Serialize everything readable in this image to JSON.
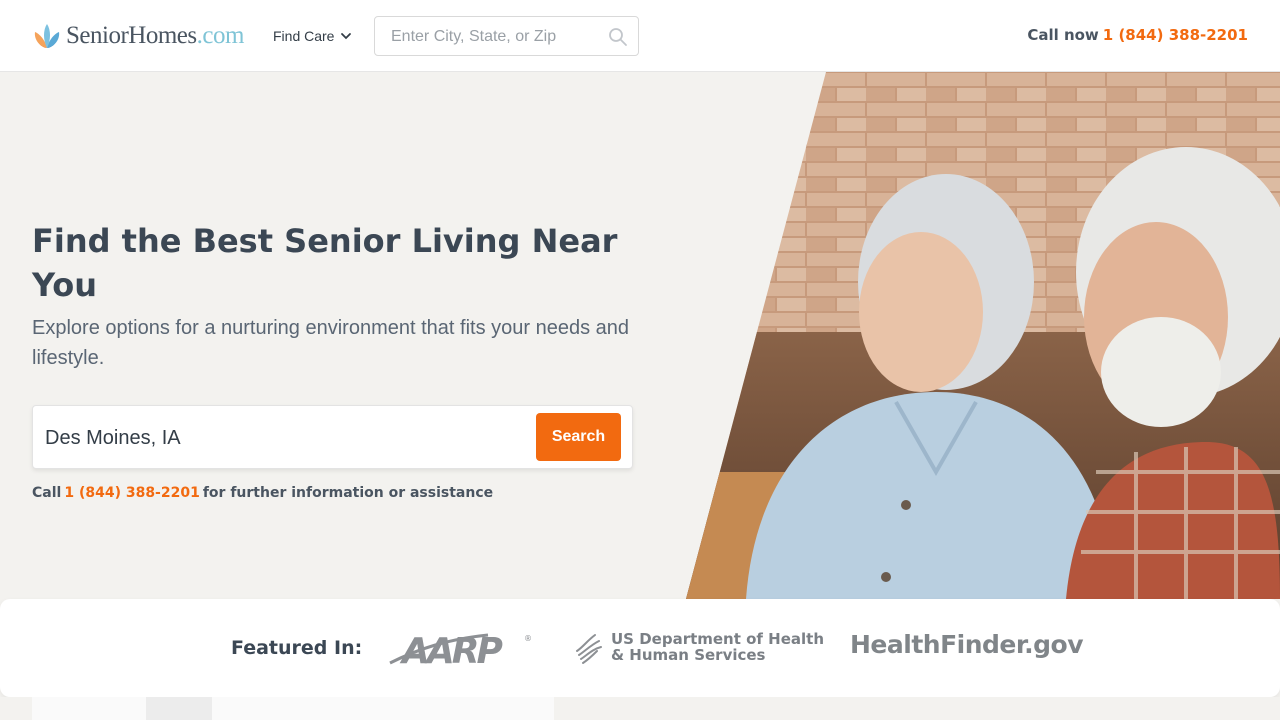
{
  "header": {
    "logo_text": "SeniorHomes",
    "logo_suffix": ".com",
    "find_care_label": "Find Care",
    "search_placeholder": "Enter City, State, or Zip",
    "call_label": "Call now",
    "phone": "1 (844) 388-2201"
  },
  "hero": {
    "title": "Find the Best Senior Living Near You",
    "subtitle": "Explore options for a nurturing environment that fits your needs and lifestyle.",
    "search_value": "Des Moines, IA",
    "search_button": "Search",
    "call_prefix": "Call",
    "call_phone": "1 (844) 388-2201",
    "call_suffix": "for further information or assistance"
  },
  "featured": {
    "label": "Featured In:",
    "logos": [
      "AARP",
      "US Department of Health & Human Services",
      "HealthFinder.gov"
    ],
    "hhs_line1": "US Department of Health",
    "hhs_line2": "& Human Services",
    "healthfinder": "HealthFinder.gov"
  },
  "colors": {
    "accent": "#f26a10",
    "text_dark": "#3b4754",
    "background": "#f3f2ef"
  }
}
